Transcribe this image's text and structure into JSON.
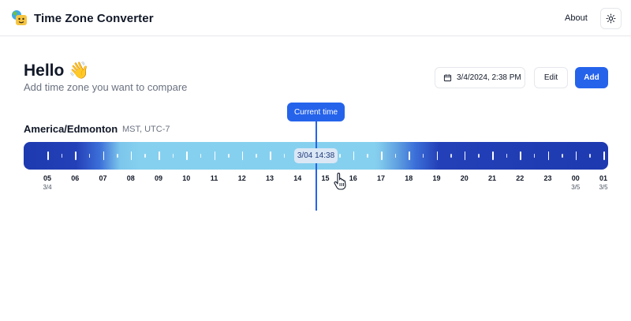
{
  "header": {
    "app_title": "Time Zone Converter",
    "about_label": "About",
    "logo_icon": "globe-face-icon",
    "theme_icon": "sun-icon"
  },
  "greeting": {
    "title": "Hello",
    "wave": "👋",
    "subtitle": "Add time zone you want to compare"
  },
  "controls": {
    "date_value": "3/4/2024, 2:38 PM",
    "calendar_icon": "calendar-icon",
    "edit_label": "Edit",
    "add_label": "Add"
  },
  "current_time_label": "Current time",
  "zone": {
    "name": "America/Edmonton",
    "meta": "MST, UTC-7",
    "badge": "3/04 14:38",
    "hours": [
      "05",
      "06",
      "07",
      "08",
      "09",
      "10",
      "11",
      "12",
      "13",
      "14",
      "15",
      "16",
      "17",
      "18",
      "19",
      "20",
      "21",
      "22",
      "23",
      "00",
      "01"
    ],
    "dates": [
      {
        "index": 0,
        "label": "3/4"
      },
      {
        "index": 19,
        "label": "3/5"
      },
      {
        "index": 20,
        "label": "3/5"
      }
    ]
  },
  "colors": {
    "accent": "#2563eb",
    "night": "#1e3ab0",
    "day": "#86d0ef"
  }
}
